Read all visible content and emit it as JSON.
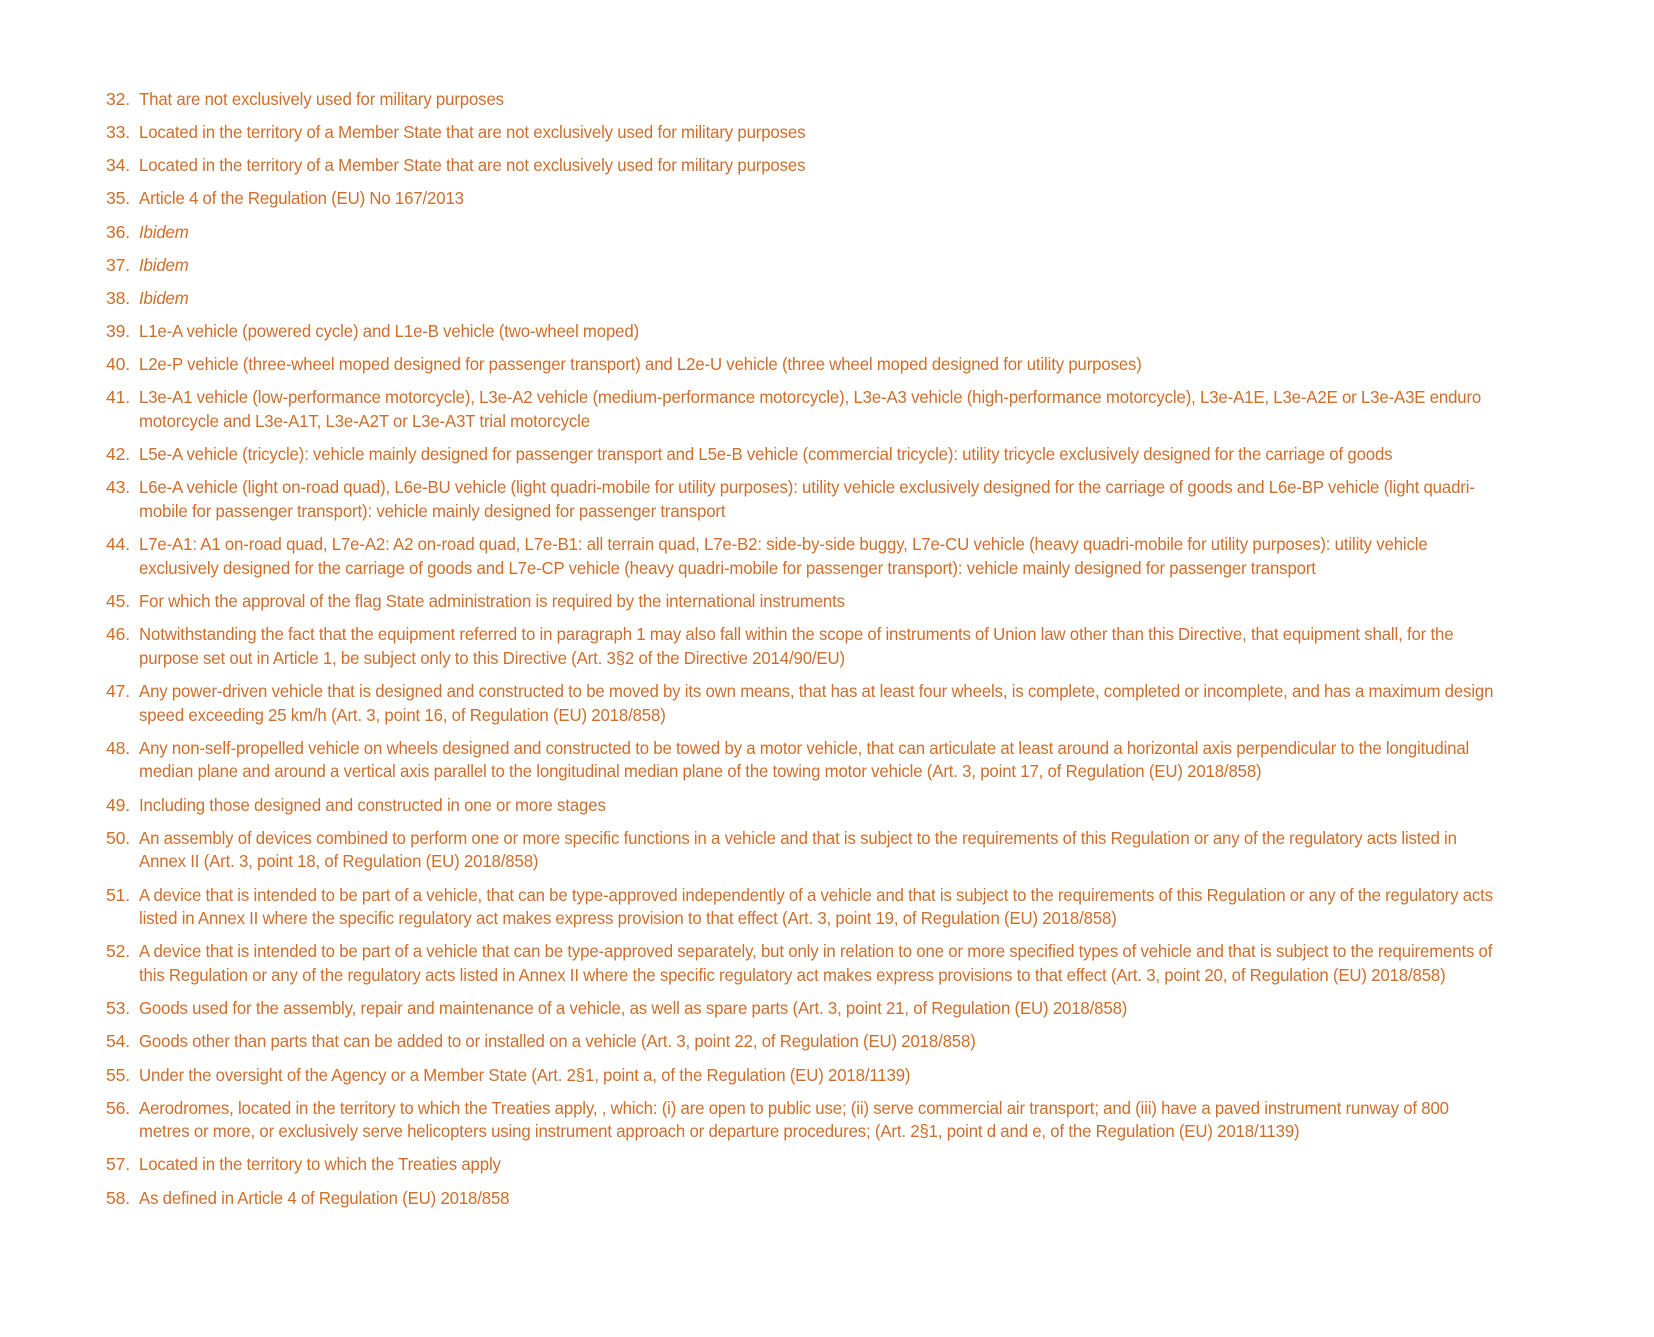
{
  "document": {
    "type": "footnote-list",
    "text_color": "#CE6E2C",
    "background_color": "#FFFFFF",
    "footnotes": [
      {
        "number": "32.",
        "text": "That are not exclusively used for military purposes",
        "italic": false
      },
      {
        "number": "33.",
        "text": "Located in the territory of a Member State that are not exclusively used for military purposes",
        "italic": false
      },
      {
        "number": "34.",
        "text": "Located in the territory of a Member State that are not exclusively used for military purposes",
        "italic": false
      },
      {
        "number": "35.",
        "text": "Article 4 of the Regulation (EU) No 167/2013",
        "italic": false
      },
      {
        "number": "36.",
        "text": "Ibidem",
        "italic": true
      },
      {
        "number": "37.",
        "text": "Ibidem",
        "italic": true
      },
      {
        "number": "38.",
        "text": "Ibidem",
        "italic": true
      },
      {
        "number": "39.",
        "text": "L1e-A vehicle (powered cycle) and L1e-B vehicle (two-wheel moped)",
        "italic": false
      },
      {
        "number": "40.",
        "text": "L2e-P vehicle (three-wheel moped designed for passenger transport) and L2e-U vehicle (three wheel moped designed for utility purposes)",
        "italic": false
      },
      {
        "number": "41.",
        "text": "L3e-A1 vehicle (low-performance motorcycle), L3e-A2 vehicle (medium-performance motorcycle), L3e-A3 vehicle (high-performance motorcycle), L3e-A1E, L3e-A2E or L3e-A3E enduro motorcycle and L3e-A1T, L3e-A2T or L3e-A3T trial motorcycle",
        "italic": false
      },
      {
        "number": "42.",
        "text": "L5e-A vehicle (tricycle): vehicle mainly designed for passenger transport and L5e-B vehicle (commercial tricycle): utility tricycle exclusively designed for the carriage of goods",
        "italic": false
      },
      {
        "number": "43.",
        "text": "L6e-A vehicle (light on-road quad), L6e-BU vehicle (light quadri-mobile for utility purposes): utility vehicle exclusively designed for the carriage of goods and L6e-BP vehicle (light quadri-mobile for passenger transport): vehicle mainly designed for passenger transport",
        "italic": false
      },
      {
        "number": "44.",
        "text": "L7e-A1: A1 on-road quad, L7e-A2: A2 on-road quad, L7e-B1: all terrain quad, L7e-B2: side-by-side buggy, L7e-CU vehicle (heavy quadri-mobile for utility purposes): utility vehicle exclusively designed for the carriage of goods and L7e-CP vehicle (heavy quadri-mobile for passenger transport): vehicle mainly designed for passenger transport",
        "italic": false
      },
      {
        "number": "45.",
        "text": "For which the approval of the flag State administration is required by the international instruments",
        "italic": false
      },
      {
        "number": "46.",
        "text": "Notwithstanding the fact that the equipment referred to in paragraph 1 may also fall within the scope of instruments of Union law other than this Directive, that equipment shall, for the purpose set out in Article 1, be subject only to this Directive (Art. 3§2 of the Directive 2014/90/EU)",
        "italic": false
      },
      {
        "number": "47.",
        "text": "Any power-driven vehicle that is designed and constructed to be moved by its own means, that has at least four wheels, is complete, completed or incomplete, and has a maximum design speed exceeding 25 km/h (Art. 3, point 16, of Regulation (EU) 2018/858)",
        "italic": false
      },
      {
        "number": "48.",
        "text": "Any non-self-propelled vehicle on wheels designed and constructed to be towed by a motor vehicle, that can articulate at least around a horizontal axis perpendicular to the longitudinal median plane and around a vertical axis parallel to the longitudinal median plane of the towing motor vehicle (Art. 3, point 17, of Regulation (EU) 2018/858)",
        "italic": false
      },
      {
        "number": "49.",
        "text": "Including those designed and constructed in one or more stages",
        "italic": false
      },
      {
        "number": "50.",
        "text": "An assembly of devices combined to perform one or more specific functions in a vehicle and that is subject to the requirements of this Regulation or any of the regulatory acts listed in Annex II (Art. 3, point 18, of Regulation (EU) 2018/858)",
        "italic": false
      },
      {
        "number": "51.",
        "text": "A device that is intended to be part of a vehicle, that can be type-approved independently of a vehicle and that is subject to the requirements of this Regulation or any of the regulatory acts listed in Annex II where the specific regulatory act makes express provision to that effect (Art. 3, point 19, of Regulation (EU) 2018/858)",
        "italic": false
      },
      {
        "number": "52.",
        "text": "A device that is intended to be part of a vehicle that can be type-approved separately, but only in relation to one or more specified types of vehicle and that is subject to the requirements of this Regulation or any of the regulatory acts listed in Annex II where the specific regulatory act makes express provisions to that effect (Art. 3, point 20, of Regulation (EU) 2018/858)",
        "italic": false
      },
      {
        "number": "53.",
        "text": "Goods used for the assembly, repair and maintenance of a vehicle, as well as spare parts (Art. 3, point 21, of Regulation (EU) 2018/858)",
        "italic": false
      },
      {
        "number": "54.",
        "text": "Goods other than parts that can be added to or installed on a vehicle (Art. 3, point 22, of Regulation (EU) 2018/858)",
        "italic": false
      },
      {
        "number": "55.",
        "text": " Under the oversight of the Agency or a Member State (Art. 2§1, point a, of the Regulation (EU) 2018/1139)",
        "italic": false
      },
      {
        "number": "56.",
        "text": "Aerodromes, located in the territory to which the Treaties apply, , which: (i) are open to public use; (ii) serve commercial air transport; and (iii) have a paved instrument runway of 800 metres or more, or exclusively serve helicopters using instrument approach or departure procedures; (Art. 2§1, point d and e, of the Regulation (EU) 2018/1139)",
        "italic": false
      },
      {
        "number": "57.",
        "text": "Located in the territory to which the Treaties apply",
        "italic": false
      },
      {
        "number": "58.",
        "text": " As defined in Article 4 of Regulation (EU) 2018/858",
        "italic": false
      }
    ]
  }
}
